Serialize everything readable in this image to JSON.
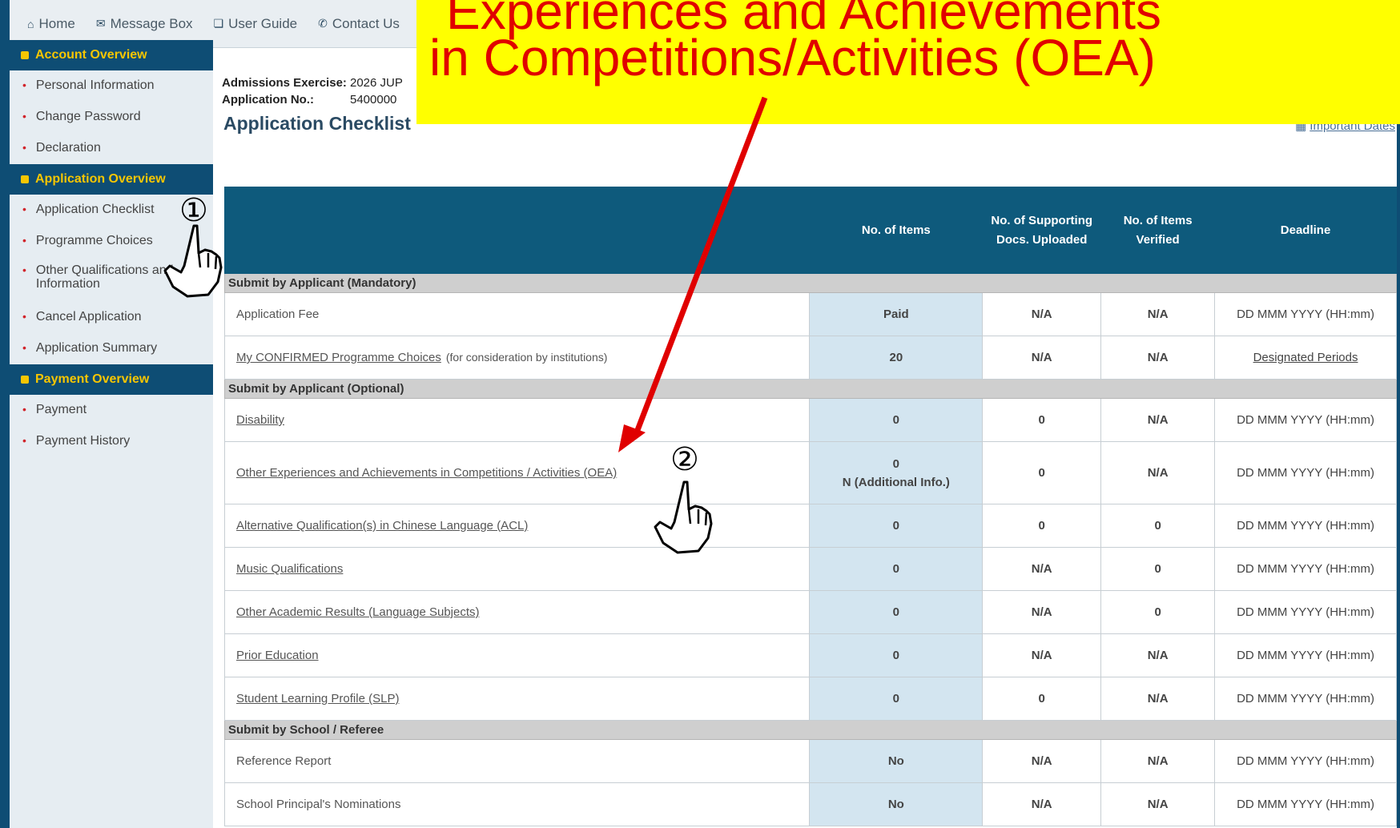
{
  "topnav": {
    "items": [
      {
        "icon": "home-icon",
        "glyph": "⌂",
        "label": "Home"
      },
      {
        "icon": "message-icon",
        "glyph": "✉",
        "label": "Message Box"
      },
      {
        "icon": "book-icon",
        "glyph": "❏",
        "label": "User Guide"
      },
      {
        "icon": "chat-icon",
        "glyph": "✆",
        "label": "Contact Us"
      }
    ]
  },
  "sidebar": {
    "sections": [
      {
        "title": "Account Overview",
        "items": [
          "Personal Information",
          "Change Password",
          "Declaration"
        ]
      },
      {
        "title": "Application Overview",
        "items": [
          "Application Checklist",
          "Programme Choices",
          "Other Qualifications and Information",
          "Cancel Application",
          "Application Summary"
        ]
      },
      {
        "title": "Payment Overview",
        "items": [
          "Payment",
          "Payment History"
        ]
      }
    ]
  },
  "info": {
    "exercise_label": "Admissions Exercise:",
    "exercise_value": "2026 JUP",
    "appno_label": "Application No.:",
    "appno_value": "5400000"
  },
  "page_title": "Application Checklist",
  "important_dates": "Important Dates",
  "table": {
    "headers": [
      "",
      "No. of Items",
      "No. of Supporting Docs. Uploaded",
      "No. of Items Verified",
      "Deadline"
    ],
    "sections": [
      {
        "title": "Submit by Applicant (Mandatory)",
        "rows": [
          {
            "name": "Application Fee",
            "link": false,
            "items": "Paid",
            "docs": "N/A",
            "verified": "N/A",
            "deadline": "DD MMM YYYY (HH:mm)"
          },
          {
            "name": "My CONFIRMED Programme Choices",
            "note": "(for consideration by institutions)",
            "link": true,
            "items": "20",
            "docs": "N/A",
            "verified": "N/A",
            "deadline": "Designated Periods",
            "deadline_link": true
          }
        ]
      },
      {
        "title": "Submit by Applicant (Optional)",
        "rows": [
          {
            "name": "Disability",
            "link": true,
            "items": "0",
            "docs": "0",
            "verified": "N/A",
            "deadline": "DD MMM YYYY (HH:mm)"
          },
          {
            "name": "Other Experiences and Achievements in Competitions / Activities (OEA)",
            "link": true,
            "items": "0",
            "items_sub": "N (Additional Info.)",
            "docs": "0",
            "verified": "N/A",
            "deadline": "DD MMM YYYY (HH:mm)"
          },
          {
            "name": "Alternative Qualification(s) in Chinese Language (ACL)",
            "link": true,
            "items": "0",
            "docs": "0",
            "verified": "0",
            "deadline": "DD MMM YYYY (HH:mm)"
          },
          {
            "name": "Music Qualifications",
            "link": true,
            "items": "0",
            "docs": "N/A",
            "verified": "0",
            "deadline": "DD MMM YYYY (HH:mm)"
          },
          {
            "name": "Other Academic Results (Language Subjects)",
            "link": true,
            "items": "0",
            "docs": "N/A",
            "verified": "0",
            "deadline": "DD MMM YYYY (HH:mm)"
          },
          {
            "name": "Prior Education",
            "link": true,
            "items": "0",
            "docs": "N/A",
            "verified": "N/A",
            "deadline": "DD MMM YYYY (HH:mm)"
          },
          {
            "name": "Student Learning Profile (SLP)",
            "link": true,
            "items": "0",
            "docs": "0",
            "verified": "N/A",
            "deadline": "DD MMM YYYY (HH:mm)"
          }
        ]
      },
      {
        "title": "Submit by School / Referee",
        "rows": [
          {
            "name": "Reference Report",
            "link": false,
            "items": "No",
            "docs": "N/A",
            "verified": "N/A",
            "deadline": "DD MMM YYYY (HH:mm)"
          },
          {
            "name": "School Principal's Nominations",
            "link": false,
            "items": "No",
            "docs": "N/A",
            "verified": "N/A",
            "deadline": "DD MMM YYYY (HH:mm)"
          }
        ]
      }
    ]
  },
  "callout": {
    "line1": "Experiences and Achievements",
    "line2": "in Competitions/Activities (OEA)",
    "bg": "#ffff00",
    "color": "#e00000"
  },
  "steps": {
    "step1": "①",
    "step2": "②"
  },
  "colors": {
    "nav_dark": "#0e4d74",
    "header_yellow": "#f7c600",
    "table_header": "#0e5a7c",
    "highlight_cell": "#d3e5f0",
    "section_grey": "#cfcfcf",
    "arrow_red": "#e00000"
  }
}
